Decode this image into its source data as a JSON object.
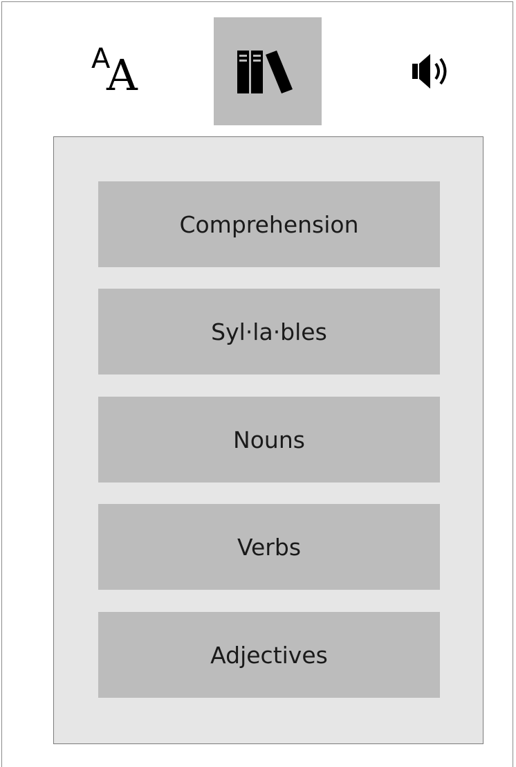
{
  "toolbar": {
    "text_button": {
      "icon": "text-size-icon",
      "small_letter": "A",
      "big_letter": "A"
    },
    "library_button": {
      "icon": "library-books-icon",
      "active": true
    },
    "audio_button": {
      "icon": "speaker-volume-icon"
    }
  },
  "menu": {
    "items": [
      {
        "label": "Comprehension"
      },
      {
        "label": "Syl·la·bles"
      },
      {
        "label": "Nouns"
      },
      {
        "label": "Verbs"
      },
      {
        "label": "Adjectives"
      }
    ]
  },
  "colors": {
    "active_toolbar_bg": "#bcbcbc",
    "panel_bg": "#e6e6e6",
    "button_bg": "#bcbcbc",
    "border": "#7a7a7a"
  }
}
